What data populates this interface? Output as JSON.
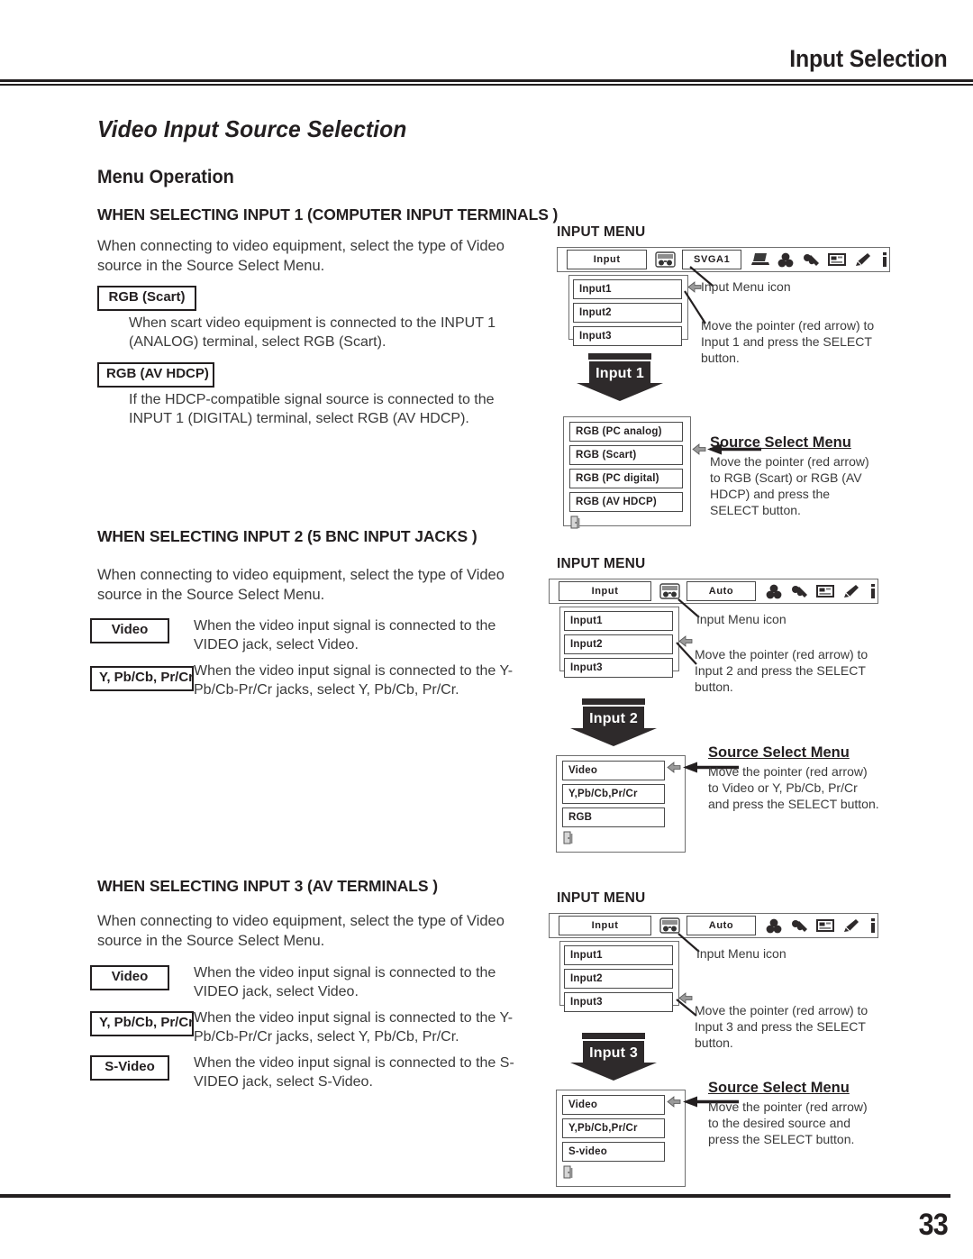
{
  "header": {
    "title": "Input Selection"
  },
  "doc": {
    "title": "Video Input Source Selection",
    "subtitle": "Menu Operation",
    "page_number": "33"
  },
  "icons": {
    "input_menu": "input-menu-icon",
    "computer": "computer-icon",
    "color_adjust": "color-adjust-icon",
    "image_adjust": "image-adjust-icon",
    "screen": "screen-icon",
    "setting": "setting-pencil-icon",
    "information": "information-icon",
    "exit": "exit-door-icon",
    "pointer": "red-arrow-pointer-icon"
  },
  "sections": [
    {
      "heading": "WHEN SELECTING INPUT 1 (COMPUTER INPUT TERMINALS )",
      "intro": "When connecting to video equipment, select the type of Video source in the Source Select Menu.",
      "items": [
        {
          "label": "RGB (Scart)",
          "desc": "When scart video equipment is connected to the INPUT 1 (ANALOG) terminal, select RGB (Scart)."
        },
        {
          "label": "RGB (AV HDCP)",
          "desc": "If the HDCP-compatible signal source is connected to the INPUT 1 (DIGITAL) terminal, select RGB (AV HDCP)."
        }
      ],
      "input_menu": {
        "title": "INPUT MENU",
        "menu_label": "Input",
        "status_value": "SVGA1",
        "items": [
          "Input1",
          "Input2",
          "Input3"
        ],
        "pointer_index": 0,
        "callout_icon": "Input Menu icon",
        "callout_action": "Move the pointer (red arrow) to Input 1 and press the SELECT button."
      },
      "banner": "Input 1",
      "source_select": {
        "title": "Source Select Menu",
        "items": [
          "RGB (PC analog)",
          "RGB (Scart)",
          "RGB (PC digital)",
          "RGB (AV HDCP)"
        ],
        "pointer_index": 1,
        "callout": "Move the pointer (red arrow) to RGB (Scart) or RGB (AV HDCP) and press the SELECT button."
      }
    },
    {
      "heading": "WHEN SELECTING INPUT 2 (5 BNC INPUT JACKS )",
      "intro": "When connecting to video equipment, select the type of Video source in the Source Select Menu.",
      "items": [
        {
          "label": "Video",
          "desc": "When the video input signal is connected to the VIDEO jack, select Video."
        },
        {
          "label": "Y, Pb/Cb, Pr/Cr",
          "desc": "When the video input signal is connected to the Y-Pb/Cb-Pr/Cr jacks, select Y, Pb/Cb, Pr/Cr."
        }
      ],
      "input_menu": {
        "title": "INPUT MENU",
        "menu_label": "Input",
        "status_value": "Auto",
        "items": [
          "Input1",
          "Input2",
          "Input3"
        ],
        "pointer_index": 1,
        "callout_icon": "Input Menu icon",
        "callout_action": "Move the pointer (red arrow) to Input 2 and press the SELECT button."
      },
      "banner": "Input 2",
      "source_select": {
        "title": "Source Select Menu",
        "items": [
          "Video",
          "Y,Pb/Cb,Pr/Cr",
          "RGB"
        ],
        "pointer_index": 0,
        "callout": "Move the pointer (red arrow) to Video or Y, Pb/Cb, Pr/Cr and press the SELECT button."
      }
    },
    {
      "heading": "WHEN SELECTING INPUT 3 (AV TERMINALS )",
      "intro": "When connecting to video equipment, select the type of Video source in the Source Select Menu.",
      "items": [
        {
          "label": "Video",
          "desc": "When the video input signal is connected to the VIDEO jack, select Video."
        },
        {
          "label": "Y, Pb/Cb, Pr/Cr",
          "desc": "When the video input signal is connected to the Y-Pb/Cb-Pr/Cr jacks, select Y, Pb/Cb, Pr/Cr."
        },
        {
          "label": "S-Video",
          "desc": "When the video input signal is connected to the S-VIDEO jack, select S-Video."
        }
      ],
      "input_menu": {
        "title": "INPUT MENU",
        "menu_label": "Input",
        "status_value": "Auto",
        "items": [
          "Input1",
          "Input2",
          "Input3"
        ],
        "pointer_index": 2,
        "callout_icon": "Input Menu icon",
        "callout_action": "Move the pointer (red arrow) to Input 3 and press the SELECT button."
      },
      "banner": "Input 3",
      "source_select": {
        "title": "Source Select Menu",
        "items": [
          "Video",
          "Y,Pb/Cb,Pr/Cr",
          "S-video"
        ],
        "pointer_index": 0,
        "callout": "Move the pointer (red arrow) to the desired source and press the SELECT button."
      }
    }
  ]
}
